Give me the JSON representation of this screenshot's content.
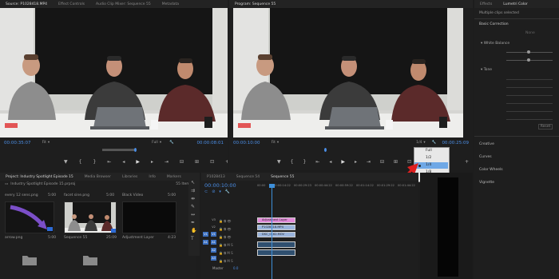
{
  "source_monitor": {
    "tabs": [
      "Source: P1028418.MP4",
      "Effect Controls",
      "Audio Clip Mixer: Sequence 55",
      "Metadata"
    ],
    "timecode_left": "00:00:35:07",
    "fit": "Fit",
    "quality": "Full",
    "timecode_right": "00:00:08:01"
  },
  "program_monitor": {
    "tabs": [
      "Program: Sequence 55"
    ],
    "timecode_left": "00:00:10:00",
    "fit": "Fit",
    "quality": "1/4",
    "timecode_right": "00:00:25:09"
  },
  "resolution_menu": {
    "items": [
      "Full",
      "1/2",
      "1/4",
      "1/8",
      "1/16"
    ],
    "selected": "1/4"
  },
  "lumetri": {
    "tabs": [
      "Effects",
      "Lumetri Color"
    ],
    "subtitle": "Multiple clips selected",
    "basic_correction": "Basic Correction",
    "none_label": "None",
    "white_balance": "White Balance",
    "tone": "Tone",
    "reset": "Reset",
    "sections": [
      "Creative",
      "Curves",
      "Color Wheels",
      "Vignette"
    ]
  },
  "project": {
    "tabs": [
      "Project: Industry Spotlight Episode 15",
      "Media Browser",
      "Libraries",
      "Info",
      "Markers"
    ],
    "path": "Industry Spotlight Episode 15.prproj",
    "count": "55 Items",
    "top_row": [
      {
        "name": "every 12 sens.png",
        "dur": "5:00"
      },
      {
        "name": "facet sine.png",
        "dur": "5:00"
      },
      {
        "name": "Black Video",
        "dur": "5:00"
      }
    ],
    "items": [
      {
        "name": "arrow.png",
        "dur": "5:00"
      },
      {
        "name": "Sequence 55",
        "dur": "25:09"
      },
      {
        "name": "Adjustment Layer",
        "dur": "4:23"
      }
    ]
  },
  "timeline": {
    "tabs": [
      "P1028413",
      "Sequence 54",
      "Sequence 55"
    ],
    "timecode": "00:00:10:00",
    "ruler": [
      "00:00",
      "00:00:14:22",
      "00:00:29:23",
      "00:00:44:22",
      "00:00:59:22",
      "00:01:14:22",
      "00:01:29:22",
      "00:01:44:22"
    ],
    "tracks": [
      "V3",
      "V2",
      "V1",
      "A1",
      "A2",
      "A3"
    ],
    "track_sources": [
      "V1",
      "A1"
    ],
    "master": "Master",
    "master_val": "0.0",
    "clips": [
      {
        "label": "Adjustment Layer",
        "kind": "adjust"
      },
      {
        "label": "P1028418.MP4",
        "kind": "video"
      },
      {
        "label": "DSC_0162.MOV",
        "kind": "video"
      }
    ]
  },
  "colors": {
    "accent": "#4b8ee6",
    "playhead": "#3d8fd9",
    "clip_video": "#9ab4dc",
    "clip_adjust": "#e28ad9",
    "arrow": "#e02020"
  }
}
